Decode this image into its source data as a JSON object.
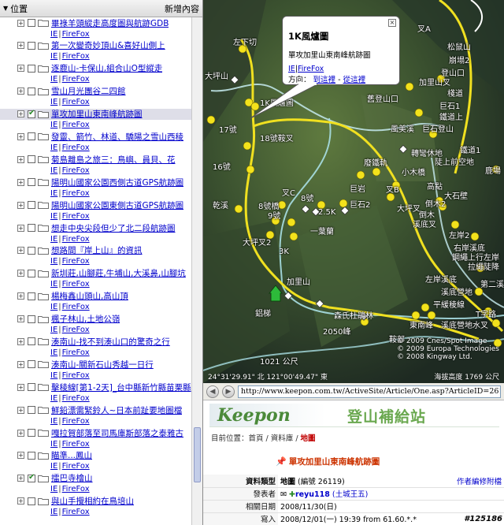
{
  "panel": {
    "header_left": "位置",
    "header_right": "新增內容",
    "items": [
      {
        "title": "畢祿羊頭縱走高度圖與航跡GDB",
        "ie": "IE",
        "ff": "FireFox",
        "checked": false
      },
      {
        "title": "第一次變奇妙頂山&喜好山側上",
        "ie": "IE",
        "ff": "FireFox",
        "checked": false
      },
      {
        "title": "逐鹿山-卡保山,組合山O型縱走",
        "ie": "IE",
        "ff": "FireFox",
        "checked": false
      },
      {
        "title": "雪山月光團谷二四館",
        "ie": "IE",
        "ff": "FireFox",
        "checked": false
      },
      {
        "title": "單攻加里山東南峰航跡圖",
        "ie": "IE",
        "ff": "FireFox",
        "checked": true
      },
      {
        "title": "發靈、箭竹、林道、驕陽之雪山西稜",
        "ie": "IE",
        "ff": "FireFox",
        "checked": false
      },
      {
        "title": "菊島離島之旅三：鳥嶼、員貝、花",
        "ie": "IE",
        "ff": "FireFox",
        "checked": false
      },
      {
        "title": "陽明山國家公園西側古道GPS航跡圖",
        "ie": "IE",
        "ff": "FireFox",
        "checked": false
      },
      {
        "title": "陽明山國家公園東側古道GPS航跡圖",
        "ie": "IE",
        "ff": "FireFox",
        "checked": false
      },
      {
        "title": "想走中央尖段但少了北二段航跡圖",
        "ie": "IE",
        "ff": "FireFox",
        "checked": false
      },
      {
        "title": "想路間『岸上山』的資訊",
        "ie": "IE",
        "ff": "FireFox",
        "checked": false
      },
      {
        "title": "新圳莊,山腳莊,牛埔山,大溪鼻,山腳坑",
        "ie": "IE",
        "ff": "FireFox",
        "checked": false
      },
      {
        "title": "楊梅鑫山頭山,高山頂",
        "ie": "IE",
        "ff": "FireFox",
        "checked": false
      },
      {
        "title": "楓子林山,土地公嶺",
        "ie": "IE",
        "ff": "FireFox",
        "checked": false
      },
      {
        "title": "湊南山-找不到湊山口的驚奇之行",
        "ie": "IE",
        "ff": "FireFox",
        "checked": false
      },
      {
        "title": "湊南山-關新石山秀越一日行",
        "ie": "IE",
        "ff": "FireFox",
        "checked": false
      },
      {
        "title": "擊稜線[第1-2天]_台中縣新竹縣苗栗縣",
        "ie": "IE",
        "ff": "FireFox",
        "checked": false
      },
      {
        "title": "鮮鉛漂需緊鈴人~日本前趾要地圖檔",
        "ie": "IE",
        "ff": "FireFox",
        "checked": false
      },
      {
        "title": "嘎拉賀部落至司馬庫斯部落之泰雅古",
        "ie": "IE",
        "ff": "FireFox",
        "checked": false
      },
      {
        "title": "瞄準...鳳山",
        "ie": "IE",
        "ff": "FireFox",
        "checked": false
      },
      {
        "title": "擂巴寺檜山",
        "ie": "IE",
        "ff": "FireFox",
        "checked": true
      },
      {
        "title": "與山手攪相約在鳥培山",
        "ie": "IE",
        "ff": "FireFox",
        "checked": false
      }
    ]
  },
  "map": {
    "balloon": {
      "title": "1K風爐圖",
      "desc": "單攻加里山東南峰航跡圖",
      "ie": "IE",
      "ff": "FireFox",
      "dir_label": "方向：",
      "dir_to": "到這裡",
      "dir_sep": "-",
      "dir_from": "從這裡"
    },
    "labels": {
      "l1": "左下切",
      "l2": "大坪山",
      "l3": "1K風爐圖",
      "l4": "17號",
      "l5": "18號鞍叉",
      "l6": "16號",
      "l7": "乾溪",
      "l8": "8號橋",
      "l9": "9號",
      "l10": "大坪叉2",
      "l11": "2.5K",
      "l12": "一葉蘭",
      "l13": "3K",
      "l14": "加里山",
      "l15": "鋁梯",
      "l16": "森氏杜鵑林",
      "l17": "2050峰",
      "l18": "鞍部",
      "l19": "東南峰",
      "l20": "巨岩",
      "l21": "巨石2",
      "l22": "叉C",
      "l23": "8號",
      "l24": "廢鐵軌",
      "l25": "小木橋",
      "l26": "叉B",
      "l27": "大坪叉",
      "l28": "加里山叉",
      "l29": "舊登山口",
      "l30": "風美溪",
      "l31": "巨石登山",
      "l32": "轉彎休地",
      "l33": "鐵道1",
      "l34": "陡上前空地",
      "l35": "大石壁",
      "l36": "溪底叉",
      "l37": "左岸2",
      "l38": "右岸溪底",
      "l39": "拉繩陡降",
      "l40": "左岸溪底",
      "l41": "溪底營地",
      "l42": "平緩稜線",
      "l43": "溪底營地水叉",
      "l44": "T字路",
      "l45": "高點",
      "l46": "倒木2",
      "l47": "鹿場",
      "l48": "崩塌2",
      "l49": "松鼠山",
      "l50": "登山口",
      "l51": "鐵道上",
      "l52": "巨石1",
      "l53": "1021 公尺",
      "l54": "棧道",
      "l55": "倒木",
      "l56": "鋼繩上行左岸",
      "l57": "第二溪",
      "l58": "叉A"
    },
    "copyright": [
      "© 2009 Cnes/Spot Image",
      "© 2009 Europa Technologies",
      "© 2008 Kingway Ltd."
    ],
    "coords": "24°31'29.91\" 北  121°00'49.47\" 東",
    "altitude": "海拔高度 1769 公尺"
  },
  "browser": {
    "url": "http://www.keepon.com.tw/ActiveSite/Article/One.asp?ArticleID=26119",
    "brand": "Keepon",
    "site_name": "登山補給站",
    "crumb_label": "目前位置：",
    "crumb_home": "首頁",
    "crumb_sep1": " / ",
    "crumb_db": "資料庫",
    "crumb_sep2": " / ",
    "crumb_cur": "地圖",
    "article_title": "單攻加里山東南峰航跡圖",
    "rows": [
      {
        "k": "資料類型",
        "v": "地圖",
        "v2": "(編號 26119)",
        "r": "作者編修附檔"
      },
      {
        "k": "發表者",
        "v": "reyu118",
        "v2": "(土城王五)",
        "r": ""
      },
      {
        "k": "相關日期",
        "v": "2008/11/30(日)",
        "v2": "",
        "r": ""
      },
      {
        "k": "寫入",
        "v": "2008/12/01(一) 19:39 from 61.60.*.*",
        "v2": "",
        "r": ""
      }
    ],
    "badge": "#125186"
  }
}
